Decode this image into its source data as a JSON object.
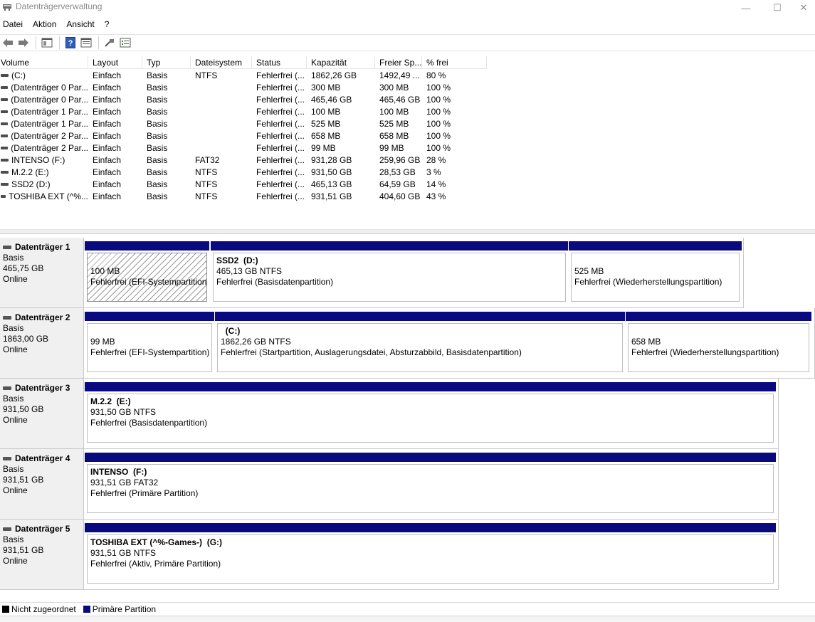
{
  "window": {
    "title": "Datenträgerverwaltung",
    "controls": {
      "minimize": "—",
      "maximize": "☐",
      "close": "✕"
    }
  },
  "menu": [
    "Datei",
    "Aktion",
    "Ansicht",
    "?"
  ],
  "toolbar": {
    "icons": [
      "back-arrow-icon",
      "forward-arrow-icon",
      "console-tree-icon",
      "help-icon",
      "properties-icon",
      "connect-icon",
      "list-view-icon"
    ]
  },
  "table": {
    "columns": [
      "Volume",
      "Layout",
      "Typ",
      "Dateisystem",
      "Status",
      "Kapazität",
      "Freier Sp...",
      "% frei"
    ],
    "rows": [
      [
        "(C:)",
        "Einfach",
        "Basis",
        "NTFS",
        "Fehlerfrei (...",
        "1862,26 GB",
        "1492,49 ...",
        "80 %"
      ],
      [
        "(Datenträger 0 Par...",
        "Einfach",
        "Basis",
        "",
        "Fehlerfrei (...",
        "300 MB",
        "300 MB",
        "100 %"
      ],
      [
        "(Datenträger 0 Par...",
        "Einfach",
        "Basis",
        "",
        "Fehlerfrei (...",
        "465,46 GB",
        "465,46 GB",
        "100 %"
      ],
      [
        "(Datenträger 1 Par...",
        "Einfach",
        "Basis",
        "",
        "Fehlerfrei (...",
        "100 MB",
        "100 MB",
        "100 %"
      ],
      [
        "(Datenträger 1 Par...",
        "Einfach",
        "Basis",
        "",
        "Fehlerfrei (...",
        "525 MB",
        "525 MB",
        "100 %"
      ],
      [
        "(Datenträger 2 Par...",
        "Einfach",
        "Basis",
        "",
        "Fehlerfrei (...",
        "658 MB",
        "658 MB",
        "100 %"
      ],
      [
        "(Datenträger 2 Par...",
        "Einfach",
        "Basis",
        "",
        "Fehlerfrei (...",
        "99 MB",
        "99 MB",
        "100 %"
      ],
      [
        "INTENSO (F:)",
        "Einfach",
        "Basis",
        "FAT32",
        "Fehlerfrei (...",
        "931,28 GB",
        "259,96 GB",
        "28 %"
      ],
      [
        "M.2.2 (E:)",
        "Einfach",
        "Basis",
        "NTFS",
        "Fehlerfrei (...",
        "931,50 GB",
        "28,53 GB",
        "3 %"
      ],
      [
        "SSD2 (D:)",
        "Einfach",
        "Basis",
        "NTFS",
        "Fehlerfrei (...",
        "465,13 GB",
        "64,59 GB",
        "14 %"
      ],
      [
        "TOSHIBA EXT (^%...",
        "Einfach",
        "Basis",
        "NTFS",
        "Fehlerfrei (...",
        "931,51 GB",
        "404,60 GB",
        "43 %"
      ]
    ]
  },
  "disks": [
    {
      "name": "Datenträger 1",
      "type": "Basis",
      "size": "465,75 GB",
      "status": "Online",
      "partitions": [
        {
          "name": "",
          "size": "100 MB",
          "status": "Fehlerfrei (EFI-Systempartition)",
          "hatched": true
        },
        {
          "name": "SSD2  (D:)",
          "size": "465,13 GB NTFS",
          "status": "Fehlerfrei (Basisdatenpartition)",
          "hatched": false
        },
        {
          "name": "",
          "size": "525 MB",
          "status": "Fehlerfrei (Wiederherstellungspartition)",
          "hatched": false
        }
      ]
    },
    {
      "name": "Datenträger 2",
      "type": "Basis",
      "size": "1863,00 GB",
      "status": "Online",
      "partitions": [
        {
          "name": "",
          "size": "99 MB",
          "status": "Fehlerfrei (EFI-Systempartition)",
          "hatched": false
        },
        {
          "name": "  (C:)",
          "size": "1862,26 GB NTFS",
          "status": "Fehlerfrei (Startpartition, Auslagerungsdatei, Absturzabbild, Basisdatenpartition)",
          "hatched": false
        },
        {
          "name": "",
          "size": "658 MB",
          "status": "Fehlerfrei (Wiederherstellungspartition)",
          "hatched": false
        }
      ]
    },
    {
      "name": "Datenträger 3",
      "type": "Basis",
      "size": "931,50 GB",
      "status": "Online",
      "partitions": [
        {
          "name": "M.2.2  (E:)",
          "size": "931,50 GB NTFS",
          "status": "Fehlerfrei (Basisdatenpartition)",
          "hatched": false
        }
      ]
    },
    {
      "name": "Datenträger 4",
      "type": "Basis",
      "size": "931,51 GB",
      "status": "Online",
      "partitions": [
        {
          "name": "INTENSO  (F:)",
          "size": "931,51 GB FAT32",
          "status": "Fehlerfrei (Primäre Partition)",
          "hatched": false
        }
      ]
    },
    {
      "name": "Datenträger 5",
      "type": "Basis",
      "size": "931,51 GB",
      "status": "Online",
      "partitions": [
        {
          "name": "TOSHIBA EXT (^%-Games-)  (G:)",
          "size": "931,51 GB NTFS",
          "status": "Fehlerfrei (Aktiv, Primäre Partition)",
          "hatched": false
        }
      ]
    }
  ],
  "legend": [
    {
      "label": "Nicht zugeordnet",
      "color": "#000000"
    },
    {
      "label": "Primäre Partition",
      "color": "#0a0a80"
    }
  ]
}
